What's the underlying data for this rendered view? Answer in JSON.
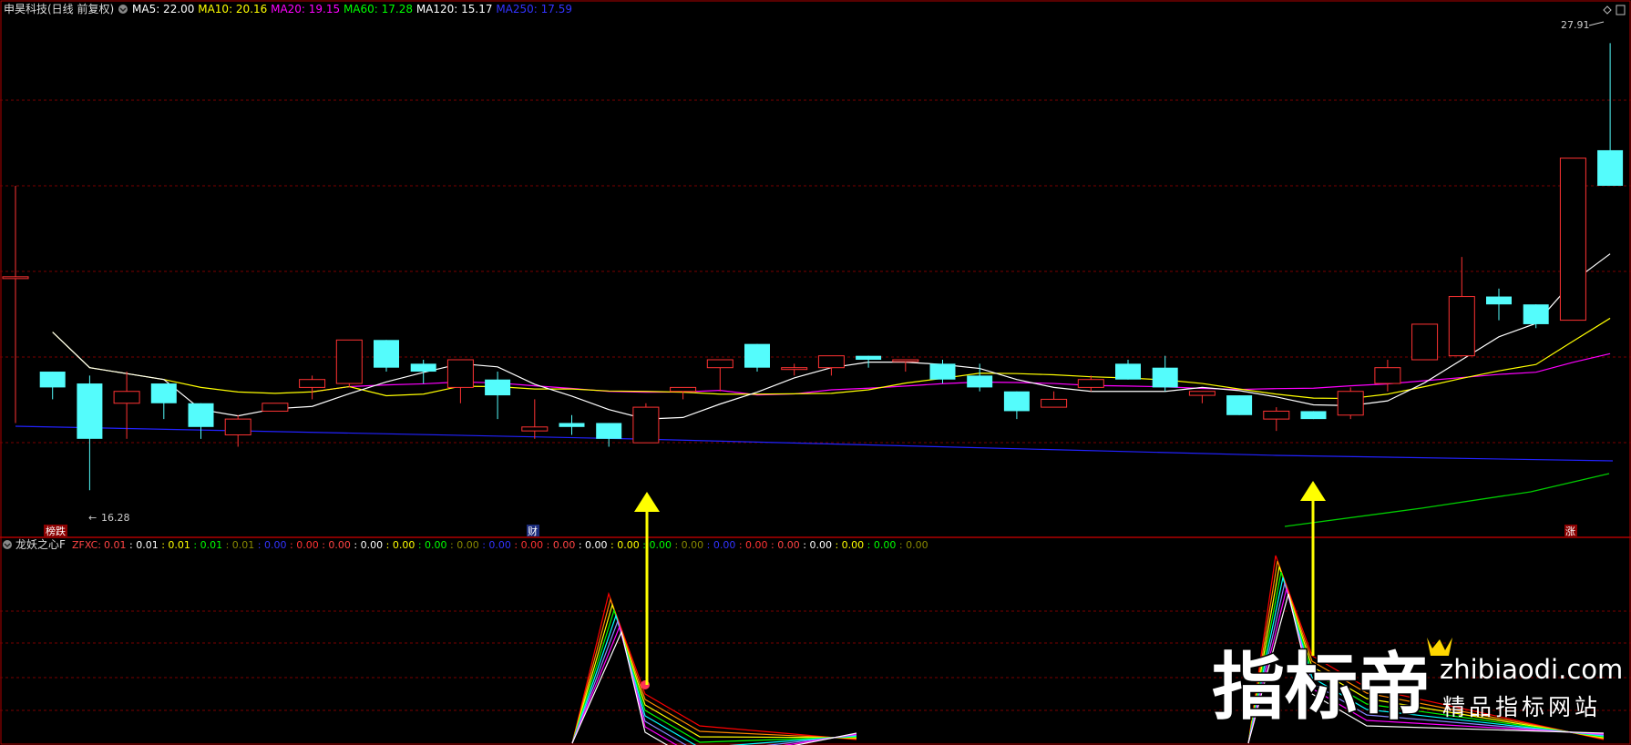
{
  "main_panel": {
    "title": "申昊科技(日线 前复权)",
    "indicators": [
      {
        "label": "MA5: 22.00",
        "color": "#ffffff"
      },
      {
        "label": "MA10: 20.16",
        "color": "#ffff00"
      },
      {
        "label": "MA20: 19.15",
        "color": "#ff00ff"
      },
      {
        "label": "MA60: 17.28",
        "color": "#00ff00"
      },
      {
        "label": "MA120: 15.17",
        "color": "#ffffff"
      },
      {
        "label": "MA250: 17.59",
        "color": "#3333ff"
      }
    ],
    "high_label": "27.91",
    "low_label": "16.28",
    "markers": {
      "left": "榜跌",
      "middle": "财",
      "right": "涨"
    }
  },
  "sub_panel": {
    "title": "龙妖之心F",
    "zfxc_label": "ZFXC:",
    "values": [
      "0.01",
      "0.01",
      "0.01",
      "0.01",
      "0.01",
      "0.00",
      "0.00",
      "0.00",
      "0.00",
      "0.00",
      "0.00",
      "0.00",
      "0.00",
      "0.00",
      "0.00",
      "0.00",
      "0.00",
      "0.00",
      "0.00",
      "0.00",
      "0.00",
      "0.00",
      "0.00",
      "0.00",
      "0.00",
      "0.00"
    ]
  },
  "colors": {
    "up": "#ff3333",
    "down": "#54fcfc",
    "grid": "#7a0000",
    "border": "#b00000",
    "arrow": "#ffff00"
  },
  "watermark": {
    "logo": "指标帝",
    "domain": "zhibiaodi.com",
    "slogan": "精品指标网站"
  },
  "chart_data": {
    "type": "candlestick",
    "price_range": [
      16.28,
      27.91
    ],
    "candles": [
      {
        "o": 22.0,
        "c": 22.0,
        "h": 24.3,
        "l": 18.3
      },
      {
        "o": 19.6,
        "c": 19.2,
        "h": 19.6,
        "l": 18.9
      },
      {
        "o": 19.3,
        "c": 17.9,
        "h": 19.5,
        "l": 16.6
      },
      {
        "o": 18.8,
        "c": 19.1,
        "h": 19.6,
        "l": 17.9
      },
      {
        "o": 19.3,
        "c": 18.8,
        "h": 19.2,
        "l": 18.4
      },
      {
        "o": 18.8,
        "c": 18.2,
        "h": 18.8,
        "l": 17.9
      },
      {
        "o": 18.0,
        "c": 18.4,
        "h": 18.5,
        "l": 17.7
      },
      {
        "o": 18.6,
        "c": 18.8,
        "h": 18.8,
        "l": 18.7
      },
      {
        "o": 19.2,
        "c": 19.4,
        "h": 19.5,
        "l": 18.9
      },
      {
        "o": 19.3,
        "c": 20.4,
        "h": 20.4,
        "l": 19.2
      },
      {
        "o": 20.4,
        "c": 19.7,
        "h": 20.4,
        "l": 19.6
      },
      {
        "o": 19.8,
        "c": 19.6,
        "h": 19.9,
        "l": 19.3
      },
      {
        "o": 19.2,
        "c": 19.9,
        "h": 19.9,
        "l": 18.8
      },
      {
        "o": 19.4,
        "c": 19.0,
        "h": 19.6,
        "l": 18.4
      },
      {
        "o": 18.1,
        "c": 18.2,
        "h": 18.9,
        "l": 17.9
      },
      {
        "o": 18.3,
        "c": 18.2,
        "h": 18.5,
        "l": 18.0
      },
      {
        "o": 18.3,
        "c": 17.9,
        "h": 18.3,
        "l": 17.7
      },
      {
        "o": 17.8,
        "c": 18.7,
        "h": 18.8,
        "l": 17.8
      },
      {
        "o": 19.1,
        "c": 19.2,
        "h": 19.2,
        "l": 18.9
      },
      {
        "o": 19.7,
        "c": 19.9,
        "h": 19.9,
        "l": 19.1
      },
      {
        "o": 20.3,
        "c": 19.7,
        "h": 20.3,
        "l": 19.6
      },
      {
        "o": 19.7,
        "c": 19.7,
        "h": 19.8,
        "l": 19.5
      },
      {
        "o": 19.7,
        "c": 20.0,
        "h": 20.0,
        "l": 19.5
      },
      {
        "o": 20.0,
        "c": 19.9,
        "h": 20.0,
        "l": 19.7
      },
      {
        "o": 19.9,
        "c": 19.9,
        "h": 19.9,
        "l": 19.6
      },
      {
        "o": 19.8,
        "c": 19.4,
        "h": 19.9,
        "l": 19.3
      },
      {
        "o": 19.5,
        "c": 19.2,
        "h": 19.8,
        "l": 19.1
      },
      {
        "o": 19.1,
        "c": 18.6,
        "h": 19.1,
        "l": 18.4
      },
      {
        "o": 18.7,
        "c": 18.9,
        "h": 19.1,
        "l": 18.7
      },
      {
        "o": 19.2,
        "c": 19.4,
        "h": 19.5,
        "l": 19.1
      },
      {
        "o": 19.8,
        "c": 19.4,
        "h": 19.9,
        "l": 19.4
      },
      {
        "o": 19.7,
        "c": 19.2,
        "h": 20.0,
        "l": 19.1
      },
      {
        "o": 19.0,
        "c": 19.1,
        "h": 19.1,
        "l": 18.8
      },
      {
        "o": 19.0,
        "c": 18.5,
        "h": 19.0,
        "l": 18.5
      },
      {
        "o": 18.4,
        "c": 18.6,
        "h": 18.7,
        "l": 18.1
      },
      {
        "o": 18.6,
        "c": 18.4,
        "h": 18.6,
        "l": 18.4
      },
      {
        "o": 18.5,
        "c": 19.1,
        "h": 19.2,
        "l": 18.4
      },
      {
        "o": 19.3,
        "c": 19.7,
        "h": 19.9,
        "l": 19.1
      },
      {
        "o": 19.9,
        "c": 20.8,
        "h": 20.8,
        "l": 19.9
      },
      {
        "o": 20.0,
        "c": 21.5,
        "h": 22.5,
        "l": 20.0
      },
      {
        "o": 21.5,
        "c": 21.3,
        "h": 21.7,
        "l": 20.9
      },
      {
        "o": 21.3,
        "c": 20.8,
        "h": 21.3,
        "l": 20.7
      },
      {
        "o": 20.9,
        "c": 25.0,
        "h": 25.0,
        "l": 20.9
      },
      {
        "o": 25.2,
        "c": 24.3,
        "h": 27.91,
        "l": 24.3
      }
    ]
  }
}
